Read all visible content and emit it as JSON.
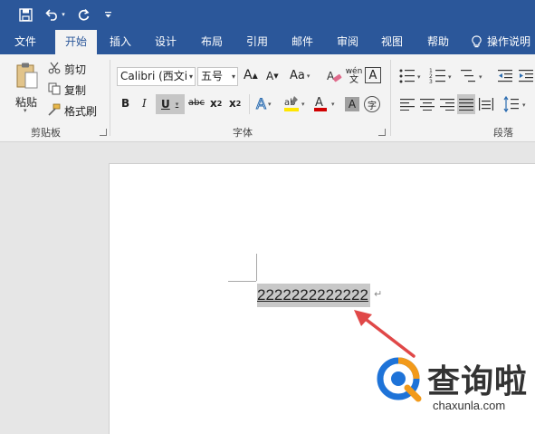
{
  "quick_access": {
    "save_icon": "save-icon",
    "undo_icon": "undo-icon",
    "redo_icon": "redo-icon",
    "customize_icon": "customize-qat-icon"
  },
  "tabs": [
    {
      "label": "文件",
      "active": false
    },
    {
      "label": "开始",
      "active": true
    },
    {
      "label": "插入",
      "active": false
    },
    {
      "label": "设计",
      "active": false
    },
    {
      "label": "布局",
      "active": false
    },
    {
      "label": "引用",
      "active": false
    },
    {
      "label": "邮件",
      "active": false
    },
    {
      "label": "审阅",
      "active": false
    },
    {
      "label": "视图",
      "active": false
    },
    {
      "label": "帮助",
      "active": false
    }
  ],
  "tell_me": "操作说明",
  "clipboard": {
    "paste": "粘贴",
    "cut": "剪切",
    "copy": "复制",
    "format_painter": "格式刷",
    "group": "剪贴板"
  },
  "font": {
    "name": "Calibri (西文i",
    "size": "五号",
    "case": "Aa",
    "group": "字体",
    "bold": "B",
    "italic": "I",
    "underline": "U",
    "strike": "abc",
    "subscript": "x",
    "superscript": "x",
    "grow": "A",
    "shrink": "A",
    "wen": "wén",
    "char_border": "A",
    "char_shading": "A",
    "enclose": "字",
    "text_effect": "A",
    "font_color": "A",
    "highlight_color": "#ffe600",
    "font_color_value": "#d00000"
  },
  "paragraph": {
    "group": "段落"
  },
  "document": {
    "text": "2222222222222",
    "para_mark": "↵"
  },
  "watermark": {
    "title": "查询啦",
    "url": "chaxunla.com"
  }
}
